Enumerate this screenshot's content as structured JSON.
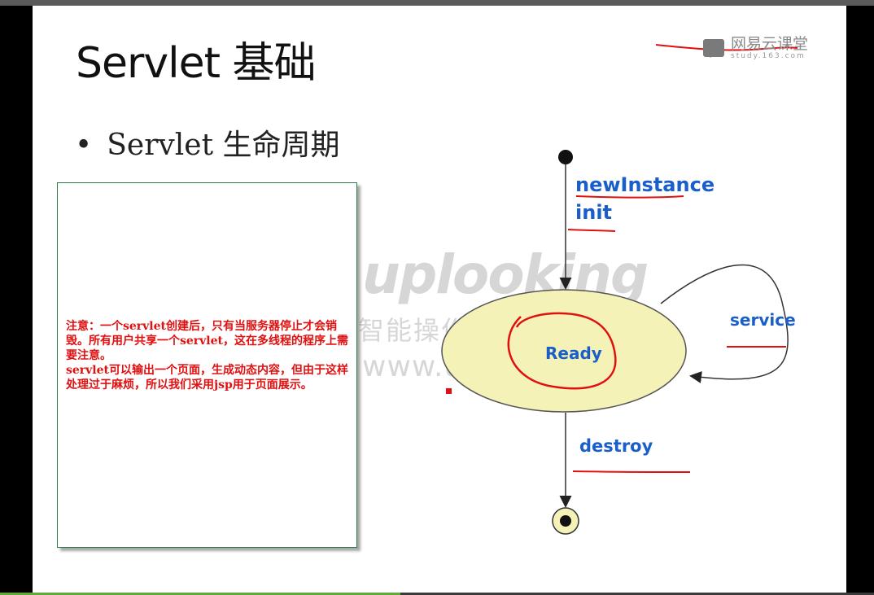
{
  "slide": {
    "title": "Servlet 基础",
    "bullet": "Servlet 生命周期"
  },
  "logo": {
    "name": "网易云课堂",
    "domain": "study.163.com"
  },
  "note": {
    "text": "注意：一个servlet创建后，只有当服务器停止才会销毁。所有用户共享一个servlet，这在多线程的程序上需要注意。\nservlet可以输出一个页面，生成动态内容，但由于这样处理过于麻烦，所以我们采用jsp用于页面展示。"
  },
  "watermark": {
    "brand": "uplooking",
    "lab": "智能操作系统研究室",
    "site": "www.up4g.com"
  },
  "lifecycle": {
    "labels": {
      "new_instance": "newInstance",
      "init": "init",
      "service": "service",
      "ready": "Ready",
      "destroy": "destroy"
    }
  },
  "colors": {
    "label_blue": "#1a5ec9",
    "annotation_red": "#e01010",
    "ellipse_fill": "#f5f2b8",
    "note_border": "#2e7d4b"
  }
}
